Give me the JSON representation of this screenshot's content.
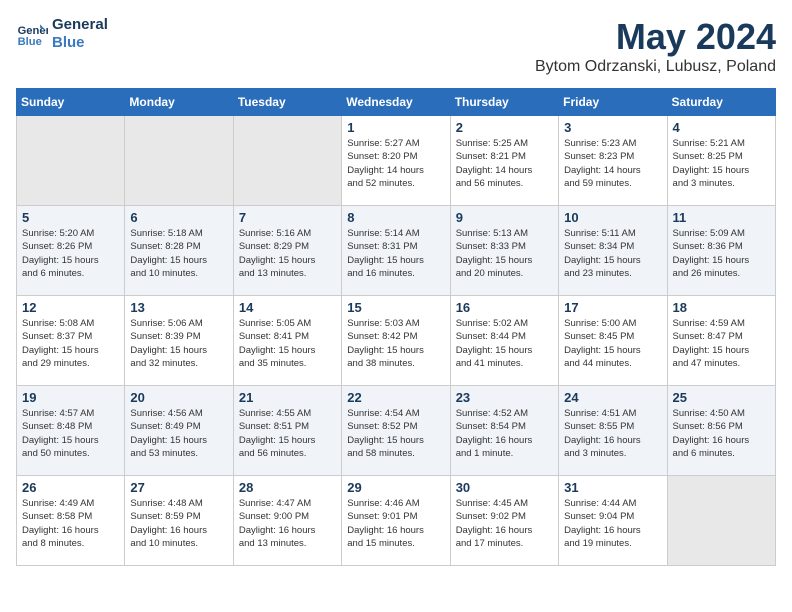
{
  "header": {
    "logo_line1": "General",
    "logo_line2": "Blue",
    "month_title": "May 2024",
    "subtitle": "Bytom Odrzanski, Lubusz, Poland"
  },
  "weekdays": [
    "Sunday",
    "Monday",
    "Tuesday",
    "Wednesday",
    "Thursday",
    "Friday",
    "Saturday"
  ],
  "weeks": [
    [
      {
        "day": "",
        "info": ""
      },
      {
        "day": "",
        "info": ""
      },
      {
        "day": "",
        "info": ""
      },
      {
        "day": "1",
        "info": "Sunrise: 5:27 AM\nSunset: 8:20 PM\nDaylight: 14 hours\nand 52 minutes."
      },
      {
        "day": "2",
        "info": "Sunrise: 5:25 AM\nSunset: 8:21 PM\nDaylight: 14 hours\nand 56 minutes."
      },
      {
        "day": "3",
        "info": "Sunrise: 5:23 AM\nSunset: 8:23 PM\nDaylight: 14 hours\nand 59 minutes."
      },
      {
        "day": "4",
        "info": "Sunrise: 5:21 AM\nSunset: 8:25 PM\nDaylight: 15 hours\nand 3 minutes."
      }
    ],
    [
      {
        "day": "5",
        "info": "Sunrise: 5:20 AM\nSunset: 8:26 PM\nDaylight: 15 hours\nand 6 minutes."
      },
      {
        "day": "6",
        "info": "Sunrise: 5:18 AM\nSunset: 8:28 PM\nDaylight: 15 hours\nand 10 minutes."
      },
      {
        "day": "7",
        "info": "Sunrise: 5:16 AM\nSunset: 8:29 PM\nDaylight: 15 hours\nand 13 minutes."
      },
      {
        "day": "8",
        "info": "Sunrise: 5:14 AM\nSunset: 8:31 PM\nDaylight: 15 hours\nand 16 minutes."
      },
      {
        "day": "9",
        "info": "Sunrise: 5:13 AM\nSunset: 8:33 PM\nDaylight: 15 hours\nand 20 minutes."
      },
      {
        "day": "10",
        "info": "Sunrise: 5:11 AM\nSunset: 8:34 PM\nDaylight: 15 hours\nand 23 minutes."
      },
      {
        "day": "11",
        "info": "Sunrise: 5:09 AM\nSunset: 8:36 PM\nDaylight: 15 hours\nand 26 minutes."
      }
    ],
    [
      {
        "day": "12",
        "info": "Sunrise: 5:08 AM\nSunset: 8:37 PM\nDaylight: 15 hours\nand 29 minutes."
      },
      {
        "day": "13",
        "info": "Sunrise: 5:06 AM\nSunset: 8:39 PM\nDaylight: 15 hours\nand 32 minutes."
      },
      {
        "day": "14",
        "info": "Sunrise: 5:05 AM\nSunset: 8:41 PM\nDaylight: 15 hours\nand 35 minutes."
      },
      {
        "day": "15",
        "info": "Sunrise: 5:03 AM\nSunset: 8:42 PM\nDaylight: 15 hours\nand 38 minutes."
      },
      {
        "day": "16",
        "info": "Sunrise: 5:02 AM\nSunset: 8:44 PM\nDaylight: 15 hours\nand 41 minutes."
      },
      {
        "day": "17",
        "info": "Sunrise: 5:00 AM\nSunset: 8:45 PM\nDaylight: 15 hours\nand 44 minutes."
      },
      {
        "day": "18",
        "info": "Sunrise: 4:59 AM\nSunset: 8:47 PM\nDaylight: 15 hours\nand 47 minutes."
      }
    ],
    [
      {
        "day": "19",
        "info": "Sunrise: 4:57 AM\nSunset: 8:48 PM\nDaylight: 15 hours\nand 50 minutes."
      },
      {
        "day": "20",
        "info": "Sunrise: 4:56 AM\nSunset: 8:49 PM\nDaylight: 15 hours\nand 53 minutes."
      },
      {
        "day": "21",
        "info": "Sunrise: 4:55 AM\nSunset: 8:51 PM\nDaylight: 15 hours\nand 56 minutes."
      },
      {
        "day": "22",
        "info": "Sunrise: 4:54 AM\nSunset: 8:52 PM\nDaylight: 15 hours\nand 58 minutes."
      },
      {
        "day": "23",
        "info": "Sunrise: 4:52 AM\nSunset: 8:54 PM\nDaylight: 16 hours\nand 1 minute."
      },
      {
        "day": "24",
        "info": "Sunrise: 4:51 AM\nSunset: 8:55 PM\nDaylight: 16 hours\nand 3 minutes."
      },
      {
        "day": "25",
        "info": "Sunrise: 4:50 AM\nSunset: 8:56 PM\nDaylight: 16 hours\nand 6 minutes."
      }
    ],
    [
      {
        "day": "26",
        "info": "Sunrise: 4:49 AM\nSunset: 8:58 PM\nDaylight: 16 hours\nand 8 minutes."
      },
      {
        "day": "27",
        "info": "Sunrise: 4:48 AM\nSunset: 8:59 PM\nDaylight: 16 hours\nand 10 minutes."
      },
      {
        "day": "28",
        "info": "Sunrise: 4:47 AM\nSunset: 9:00 PM\nDaylight: 16 hours\nand 13 minutes."
      },
      {
        "day": "29",
        "info": "Sunrise: 4:46 AM\nSunset: 9:01 PM\nDaylight: 16 hours\nand 15 minutes."
      },
      {
        "day": "30",
        "info": "Sunrise: 4:45 AM\nSunset: 9:02 PM\nDaylight: 16 hours\nand 17 minutes."
      },
      {
        "day": "31",
        "info": "Sunrise: 4:44 AM\nSunset: 9:04 PM\nDaylight: 16 hours\nand 19 minutes."
      },
      {
        "day": "",
        "info": ""
      }
    ]
  ]
}
